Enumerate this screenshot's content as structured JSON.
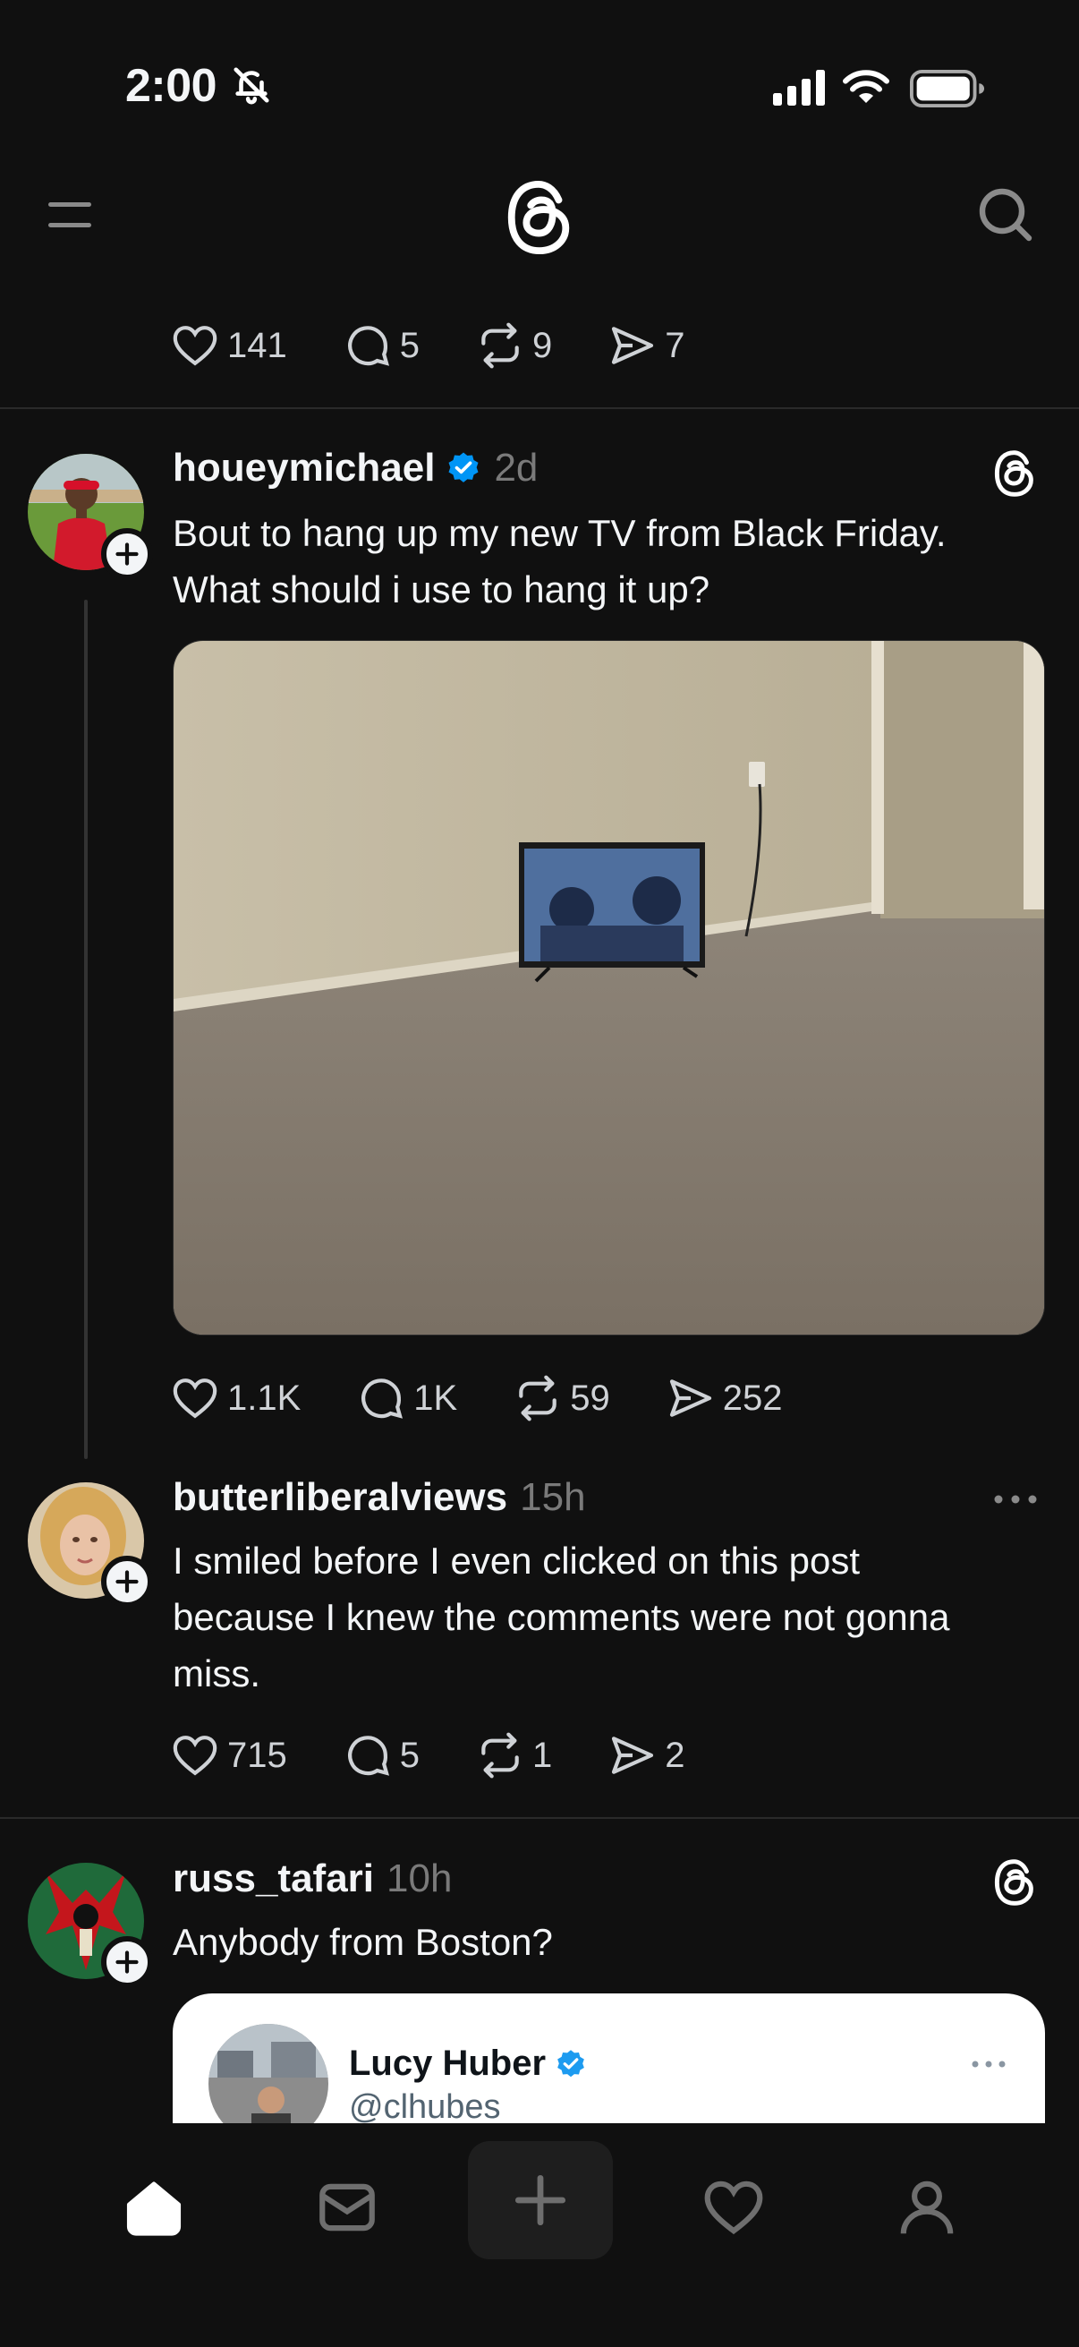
{
  "status_bar": {
    "time": "2:00",
    "icons": [
      "bell-slash-icon",
      "signal-icon",
      "wifi-icon",
      "battery-icon"
    ]
  },
  "header": {
    "icons": [
      "menu-icon",
      "threads-logo-icon",
      "search-icon"
    ]
  },
  "previous_post_stats": {
    "likes": "141",
    "replies": "5",
    "reposts": "9",
    "shares": "7"
  },
  "posts": [
    {
      "username": "houeymichael",
      "verified": true,
      "time": "2d",
      "text_lines": [
        "Bout to hang up my new TV from Black Friday.",
        "What should i use to hang it up?"
      ],
      "has_image": true,
      "stats": {
        "likes": "1.1K",
        "replies": "1K",
        "reposts": "59",
        "shares": "252"
      }
    },
    {
      "username": "butterliberalviews",
      "verified": false,
      "time": "15h",
      "text_lines": [
        "I smiled before I even clicked on this post",
        "because I knew the comments were not gonna",
        "miss."
      ],
      "stats": {
        "likes": "715",
        "replies": "5",
        "reposts": "1",
        "shares": "2"
      }
    },
    {
      "username": "russ_tafari",
      "verified": false,
      "time": "10h",
      "text_lines": [
        "Anybody from Boston?"
      ],
      "quote": {
        "name": "Lucy Huber",
        "handle": "@clhubes",
        "verified": true
      }
    }
  ],
  "tab_bar": {
    "tabs": [
      "home-icon",
      "inbox-icon",
      "create-icon",
      "activity-heart-icon",
      "profile-icon"
    ],
    "active": "home-icon"
  },
  "colors": {
    "background": "#101010",
    "text": "#f3f5f7",
    "muted": "#7a7a7a",
    "verified_blue": "#0095f6"
  }
}
